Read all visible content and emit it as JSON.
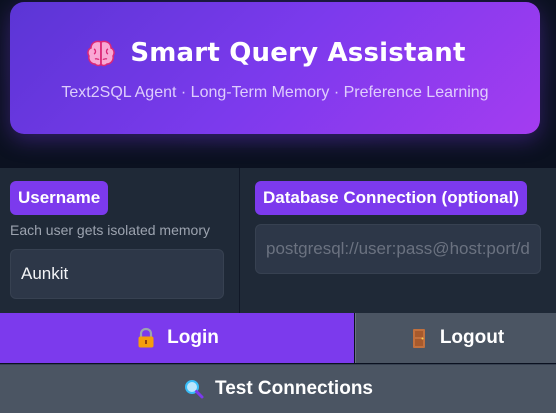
{
  "hero": {
    "title": "Smart Query Assistant",
    "subtitle": "Text2SQL Agent · Long-Term Memory · Preference Learning",
    "icon": "brain-icon"
  },
  "form": {
    "username_label": "Username",
    "username_hint": "Each user gets isolated memory",
    "username_value": "Aunkit",
    "db_label": "Database Connection (optional)",
    "db_placeholder": "postgresql://user:pass@host:port/db",
    "db_value": ""
  },
  "buttons": {
    "login_label": "Login",
    "login_icon": "lock-icon",
    "logout_label": "Logout",
    "logout_icon": "door-icon",
    "test_label": "Test Connections",
    "test_icon": "magnifier-icon"
  },
  "colors": {
    "accent": "#7c3aed",
    "hero_gradient_start": "#5b35d5",
    "hero_gradient_end": "#a43cf0",
    "panel_bg": "#1f2937",
    "secondary_button": "#4b5563",
    "page_bg": "#0b1120"
  }
}
